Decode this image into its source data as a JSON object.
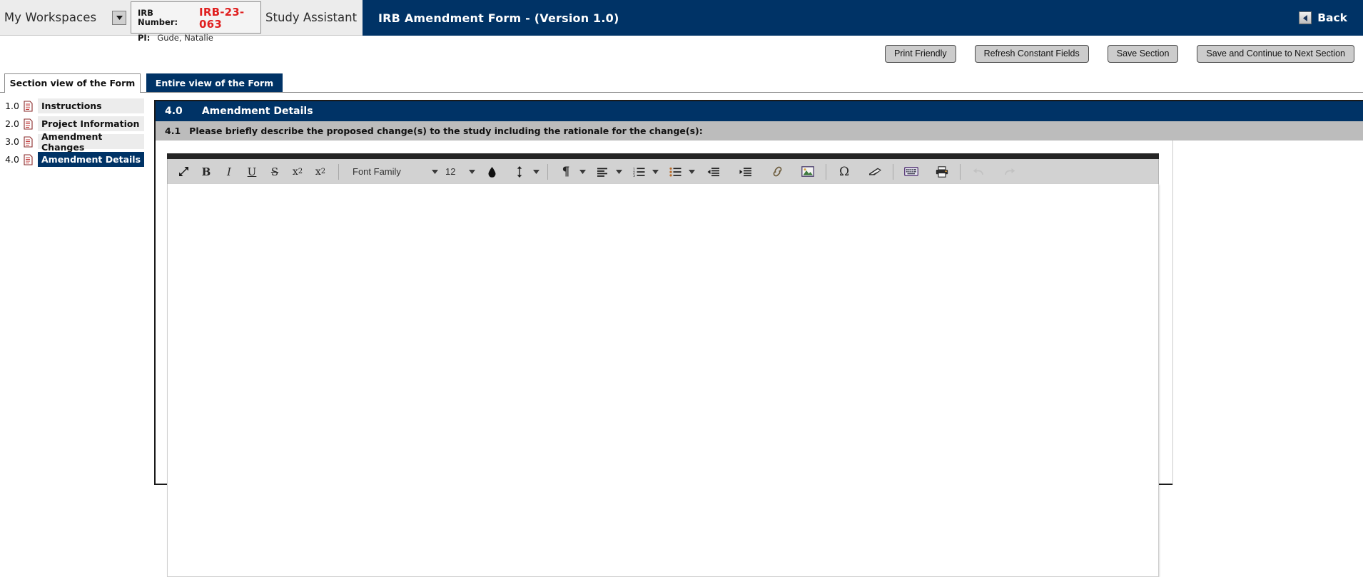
{
  "topbar": {
    "workspaces_label": "My Workspaces",
    "workspaces_caret_icon": "chevron-down-icon",
    "irb_number_key": "IRB Number:",
    "irb_number_value": "IRB-23-063",
    "pi_key": "PI:",
    "pi_value": "Gude, Natalie",
    "study_assistant_label": "Study Assistant",
    "form_title": "IRB Amendment Form - (Version 1.0)",
    "back_label": "Back",
    "back_icon": "arrow-left-icon",
    "brand_color": "#003366",
    "irb_number_color": "#e02020"
  },
  "actions": [
    {
      "label": "Print Friendly"
    },
    {
      "label": "Refresh Constant Fields"
    },
    {
      "label": "Save Section"
    },
    {
      "label": "Save and Continue to Next Section"
    }
  ],
  "tabs": [
    {
      "label": "Section view of the Form",
      "active": true
    },
    {
      "label": "Entire view of the Form",
      "active": false
    }
  ],
  "sidebar": {
    "items": [
      {
        "number": "1.0",
        "label": "Instructions",
        "icon": "document-icon",
        "active": false
      },
      {
        "number": "2.0",
        "label": "Project Information",
        "icon": "document-icon",
        "active": false
      },
      {
        "number": "3.0",
        "label": "Amendment Changes",
        "icon": "document-icon",
        "active": false
      },
      {
        "number": "4.0",
        "label": "Amendment Details",
        "icon": "document-icon",
        "active": true
      }
    ]
  },
  "section": {
    "number": "4.0",
    "title": "Amendment Details",
    "question_number": "4.1",
    "question_text": "Please briefly describe the proposed change(s) to the study including the rationale for the change(s):"
  },
  "editor": {
    "font_family_value": "Font Family",
    "font_size_value": "12",
    "content": "",
    "toolbar": [
      {
        "name": "expand-icon",
        "glyph": "↗",
        "kind": "icon"
      },
      {
        "name": "bold-icon",
        "glyph": "B",
        "kind": "bold"
      },
      {
        "name": "italic-icon",
        "glyph": "I",
        "kind": "italic"
      },
      {
        "name": "underline-icon",
        "glyph": "U",
        "kind": "underline"
      },
      {
        "name": "strikethrough-icon",
        "glyph": "S",
        "kind": "strike"
      },
      {
        "name": "subscript-icon",
        "glyph": "x",
        "kind": "sub"
      },
      {
        "name": "superscript-icon",
        "glyph": "x",
        "kind": "sup"
      },
      {
        "name": "separator",
        "kind": "sep"
      },
      {
        "name": "font-family-select",
        "kind": "font-family"
      },
      {
        "name": "font-size-select",
        "kind": "font-size"
      },
      {
        "name": "text-color-icon",
        "glyph": "◆",
        "kind": "droplet"
      },
      {
        "name": "line-height-icon",
        "glyph": "↕",
        "kind": "lineheight"
      },
      {
        "name": "separator",
        "kind": "sep"
      },
      {
        "name": "paragraph-format-icon",
        "glyph": "¶",
        "kind": "pilcrow"
      },
      {
        "name": "align-icon",
        "glyph": "≡",
        "kind": "align"
      },
      {
        "name": "ordered-list-icon",
        "glyph": "1.",
        "kind": "ol"
      },
      {
        "name": "unordered-list-icon",
        "glyph": "•",
        "kind": "ul"
      },
      {
        "name": "outdent-icon",
        "glyph": "←",
        "kind": "outdent"
      },
      {
        "name": "indent-icon",
        "glyph": "→",
        "kind": "indent"
      },
      {
        "name": "link-icon",
        "glyph": "⚭",
        "kind": "link"
      },
      {
        "name": "image-icon",
        "glyph": "ὛB",
        "kind": "image"
      },
      {
        "name": "separator",
        "kind": "sep"
      },
      {
        "name": "special-character-icon",
        "glyph": "Ω",
        "kind": "omega"
      },
      {
        "name": "clear-formatting-icon",
        "glyph": "▰",
        "kind": "eraser"
      },
      {
        "name": "separator",
        "kind": "sep"
      },
      {
        "name": "keyboard-shortcuts-icon",
        "glyph": "⌨",
        "kind": "keyboard"
      },
      {
        "name": "print-icon",
        "glyph": "⎙",
        "kind": "print"
      },
      {
        "name": "separator",
        "kind": "sep"
      },
      {
        "name": "undo-icon",
        "glyph": "↶",
        "kind": "undo",
        "disabled": true
      },
      {
        "name": "redo-icon",
        "glyph": "↷",
        "kind": "redo",
        "disabled": true
      }
    ]
  }
}
